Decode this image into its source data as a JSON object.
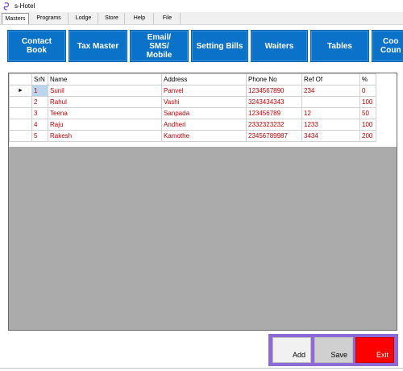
{
  "window": {
    "title": "s-Hotel"
  },
  "menu": [
    "Masters",
    "Programs",
    "Lodge",
    "Store",
    "Help",
    "File"
  ],
  "toolbar": {
    "contact_book": "Contact\nBook",
    "tax_master": "Tax Master",
    "email_sms": "Email/\nSMS/\nMobile",
    "setting_bills": "Setting Bills",
    "waiters": "Waiters",
    "tables": "Tables",
    "cook_counter": "Coo\nCoun"
  },
  "grid": {
    "columns": [
      "SrN",
      "Name",
      "Address",
      "Phone No",
      "Ref Of",
      "%"
    ],
    "rows": [
      {
        "sr": "1",
        "name": "Sunil",
        "address": "Panvel",
        "phone": "1234567890",
        "ref": "234",
        "pct": "0"
      },
      {
        "sr": "2",
        "name": "Rahul",
        "address": "Vashi",
        "phone": "3243434343",
        "ref": "",
        "pct": "100"
      },
      {
        "sr": "3",
        "name": "Teena",
        "address": "Sanpada",
        "phone": "123456789",
        "ref": "12",
        "pct": "50"
      },
      {
        "sr": "4",
        "name": "Raju",
        "address": "Andheri",
        "phone": "2332323232",
        "ref": "1233",
        "pct": "100"
      },
      {
        "sr": "5",
        "name": "Rakesh",
        "address": "Kamothe",
        "phone": "23456789987",
        "ref": "3434",
        "pct": "200"
      }
    ],
    "current_row_marker": "►"
  },
  "actions": {
    "add": "Add",
    "save": "Save",
    "exit": "Exit"
  },
  "colors": {
    "toolbar_button": "#0b72c9",
    "grid_text": "#c00000",
    "exit": "#ff0000",
    "button_group": "#8d6ad6"
  }
}
